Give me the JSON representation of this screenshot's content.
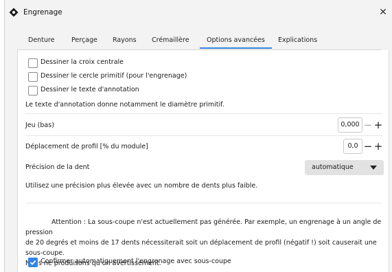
{
  "window": {
    "title": "Engrenage",
    "close_glyph": "✕"
  },
  "tabs": [
    {
      "label": "Denture"
    },
    {
      "label": "Perçage"
    },
    {
      "label": "Rayons"
    },
    {
      "label": "Crémaillère"
    },
    {
      "label": "Options avancées",
      "active": true
    },
    {
      "label": "Explications"
    }
  ],
  "options": {
    "draw_center_cross": {
      "label": "Dessiner la croix centrale",
      "checked": false
    },
    "draw_pitch_circle": {
      "label": "Dessiner le cercle primitif (pour l'engrenage)",
      "checked": false
    },
    "draw_annotation": {
      "label": "Dessiner le texte d'annotation",
      "checked": false
    },
    "annotation_note": "Le texte d'annotation donne notamment le diamètre primitif.",
    "backlash": {
      "label": "Jeu (bas)",
      "value": "0,000",
      "minus": "−",
      "plus": "+"
    },
    "profile_shift": {
      "label": "Déplacement de profil [% du module]",
      "value": "0,0",
      "minus": "−",
      "plus": "+"
    },
    "tooth_precision": {
      "label": "Précision de la dent",
      "selected": "automatique"
    },
    "precision_note": "Utilisez une précision plus élevée avec un nombre de dents plus faible.",
    "warning_line1": "Attention : La sous-coupe n'est actuellement pas générée. Par exemple, un engrenage à un angle de pression",
    "warning_line2": "de 20 degrés et moins de 17 dents nécessiterait soit un déplacement de profil (négatif !) soit causerait une sous-coupe.",
    "warning_line3": "Nous ne produisons qu'un avertissement.",
    "confirm_undercut": {
      "label": "Confirmer automatiquement l'engrenage avec sous-coupe",
      "checked": true
    }
  },
  "icons": {
    "app": "gear-icon",
    "close": "close-icon",
    "dropdown": "chevron-down-icon",
    "check": "checkmark-icon"
  },
  "colors": {
    "accent": "#3584e4",
    "background": "#f3f3f3",
    "panel": "#ffffff"
  }
}
